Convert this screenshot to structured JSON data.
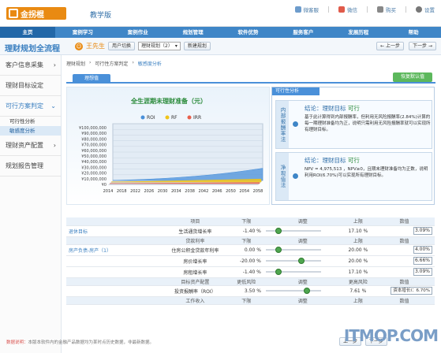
{
  "app": {
    "logo_text": "金拐棍",
    "edition": "教学版",
    "top_links": [
      "微客服",
      "微信",
      "购买",
      "设置"
    ]
  },
  "nav": {
    "items": [
      "主页",
      "案例学习",
      "案例作业",
      "规划管理",
      "软件优势",
      "服务客户",
      "发展历程",
      "帮助"
    ],
    "active_index": 0
  },
  "subhead": {
    "title": "理财规划全流程",
    "user_name": "王先生",
    "switch_user_label": "用户切换",
    "plan_select": "理财规划（2）",
    "new_plan_label": "新建规划",
    "prev_label": "上一步",
    "next_label": "下一步"
  },
  "sidebar": {
    "items": [
      {
        "label": "客户信息采集",
        "arrow": "›"
      },
      {
        "label": "理财目标设定",
        "arrow": ""
      },
      {
        "label": "可行方案判定",
        "arrow": "⌄"
      },
      {
        "label": "理财资产配置",
        "arrow": "›"
      },
      {
        "label": "规划报告管理",
        "arrow": ""
      }
    ],
    "subitems": [
      "可行性分析",
      "敏感度分析"
    ]
  },
  "breadcrumb": [
    "理财规划",
    "可行性方案判定",
    "敏感度分析"
  ],
  "tabs": {
    "active": "理想值",
    "right_button": "恢复默认值"
  },
  "chart": {
    "title": "全生涯期未理财准备（元）",
    "legend": [
      "ROI",
      "RF",
      "IRR"
    ],
    "y_ticks": [
      "¥100,000,000",
      "¥90,000,000",
      "¥80,000,000",
      "¥70,000,000",
      "¥60,000,000",
      "¥50,000,000",
      "¥40,000,000",
      "¥30,000,000",
      "¥20,000,000",
      "¥10,000,000",
      "¥0"
    ],
    "x_ticks": [
      "2014",
      "2018",
      "2022",
      "2026",
      "2030",
      "2034",
      "2038",
      "2042",
      "2046",
      "2050",
      "2054",
      "2058"
    ]
  },
  "chart_data": {
    "type": "area",
    "title": "全生涯期未理财准备（元）",
    "x": [
      "2014",
      "2018",
      "2022",
      "2026",
      "2030",
      "2034",
      "2038",
      "2042",
      "2046",
      "2050",
      "2054",
      "2058"
    ],
    "ylim": [
      0,
      100000000
    ],
    "legend_position": "top",
    "series": [
      {
        "name": "ROI",
        "color": "#4a90d9",
        "values": [
          200000,
          800000,
          1600000,
          2700000,
          4000000,
          5600000,
          7400000,
          9500000,
          12000000,
          14800000,
          18000000,
          21500000
        ]
      },
      {
        "name": "RF",
        "color": "#f0c419",
        "values": [
          200000,
          500000,
          900000,
          1300000,
          1800000,
          2300000,
          2800000,
          3300000,
          3800000,
          4300000,
          4800000,
          5300000
        ]
      },
      {
        "name": "IRR",
        "color": "#e8604c",
        "values": [
          200000,
          350000,
          500000,
          650000,
          800000,
          950000,
          1100000,
          1250000,
          1400000,
          1550000,
          1700000,
          1850000
        ]
      }
    ]
  },
  "feasibility": {
    "header": "可行性分析",
    "rows": [
      {
        "label": "内部报酬率法",
        "conclusion_prefix": "结论：理财目标 ",
        "conclusion_value": "可行",
        "text": "基于此计算得到内部报酬率，但利用无风险报酬率(2.84%)计算的每一期理财准备均为正，说明只需利用无风险报酬率就可以实现所有理财目标。"
      },
      {
        "label": "净现值法",
        "conclusion_prefix": "结论：理财目标 ",
        "conclusion_value": "可行",
        "text": "NPV = 4,975,513 ，NPV≥0，且期末理财准备均为正数，说明利用ROI(6.70%)可以实现所有理财目标。"
      }
    ]
  },
  "table": {
    "sections": [
      {
        "headers": [
          "项目",
          "下限",
          "调整",
          "上限",
          "数值"
        ],
        "group": "退休目标",
        "rows": [
          {
            "name": "生活通货增长率",
            "min": "-1.40 %",
            "pos": 0.2,
            "max": "17.10 %",
            "value": "3.09%"
          }
        ]
      },
      {
        "headers": [
          "贷款利率",
          "下限",
          "调整",
          "上限",
          "数值"
        ],
        "group": "房产负债-房产（1）",
        "rows": [
          {
            "name": "住房公积金贷款年利率",
            "min": "0.00 %",
            "pos": 0.2,
            "max": "20.00 %",
            "value": "4.00%"
          },
          {
            "name": "房价增长率",
            "min": "-20.00 %",
            "pos": 0.67,
            "max": "20.00 %",
            "value": "6.66%"
          },
          {
            "name": "房租增长率",
            "min": "-1.40 %",
            "pos": 0.2,
            "max": "17.10 %",
            "value": "3.09%"
          }
        ]
      },
      {
        "headers": [
          "目标资产配置",
          "更低风险",
          "调整",
          "更高风险",
          "数值"
        ],
        "group": "",
        "rows": [
          {
            "name": "投资报酬率（ROI）",
            "min": "3.50 %",
            "pos": 0.77,
            "max": "7.61 %",
            "value": "资本增长Ⅰ：6.70%"
          }
        ]
      },
      {
        "headers": [
          "工作收入",
          "下限",
          "调整",
          "上限",
          "数值"
        ],
        "group": "",
        "rows": []
      }
    ]
  },
  "footer": {
    "label": "数据说明：",
    "text": "本版本软件内的金融产品数据均为某时点历史数据，非最新数据。",
    "prev_label": "上一步",
    "next_label": "下一步"
  },
  "watermark": "ITMOP.COM"
}
